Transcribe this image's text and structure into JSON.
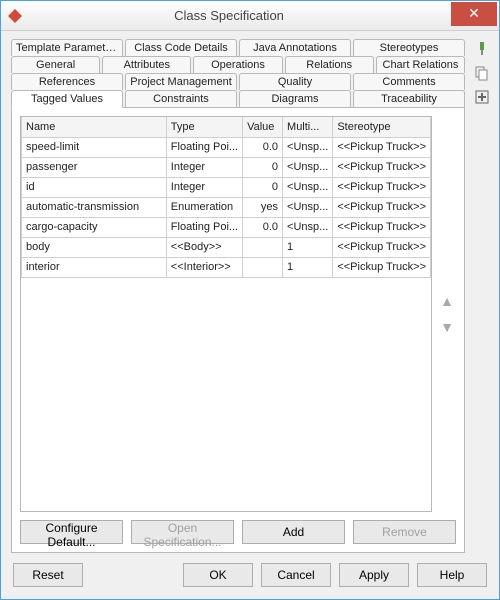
{
  "titlebar": {
    "title": "Class Specification"
  },
  "tabs": {
    "row1": [
      "Template Parameters",
      "Class Code Details",
      "Java Annotations",
      "Stereotypes"
    ],
    "row2": [
      "General",
      "Attributes",
      "Operations",
      "Relations",
      "Chart Relations"
    ],
    "row3": [
      "References",
      "Project Management",
      "Quality",
      "Comments"
    ],
    "row4": [
      "Tagged Values",
      "Constraints",
      "Diagrams",
      "Traceability"
    ],
    "active": "Tagged Values"
  },
  "table": {
    "headers": [
      "Name",
      "Type",
      "Value",
      "Multi...",
      "Stereotype"
    ],
    "rows": [
      {
        "name": "speed-limit",
        "type": "Floating Poi...",
        "value": "0.0",
        "multi": "<Unsp...",
        "stereo": "<<Pickup Truck>>"
      },
      {
        "name": "passenger",
        "type": "Integer",
        "value": "0",
        "multi": "<Unsp...",
        "stereo": "<<Pickup Truck>>"
      },
      {
        "name": "id",
        "type": "Integer",
        "value": "0",
        "multi": "<Unsp...",
        "stereo": "<<Pickup Truck>>"
      },
      {
        "name": "automatic-transmission",
        "type": "Enumeration",
        "value": "yes",
        "multi": "<Unsp...",
        "stereo": "<<Pickup Truck>>"
      },
      {
        "name": "cargo-capacity",
        "type": "Floating Poi...",
        "value": "0.0",
        "multi": "<Unsp...",
        "stereo": "<<Pickup Truck>>"
      },
      {
        "name": "body",
        "type": "<<Body>>",
        "value": "",
        "multi": "1",
        "stereo": "<<Pickup Truck>>"
      },
      {
        "name": "interior",
        "type": "<<Interior>>",
        "value": "",
        "multi": "1",
        "stereo": "<<Pickup Truck>>"
      }
    ]
  },
  "tab_buttons": {
    "configure": "Configure Default...",
    "openspec": "Open Specification...",
    "add": "Add",
    "remove": "Remove"
  },
  "footer": {
    "reset": "Reset",
    "ok": "OK",
    "cancel": "Cancel",
    "apply": "Apply",
    "help": "Help"
  },
  "icons": {
    "close": "✕",
    "pin": "pin-icon",
    "copy": "copy-icon",
    "add": "add-icon",
    "up": "▲",
    "down": "▼"
  }
}
